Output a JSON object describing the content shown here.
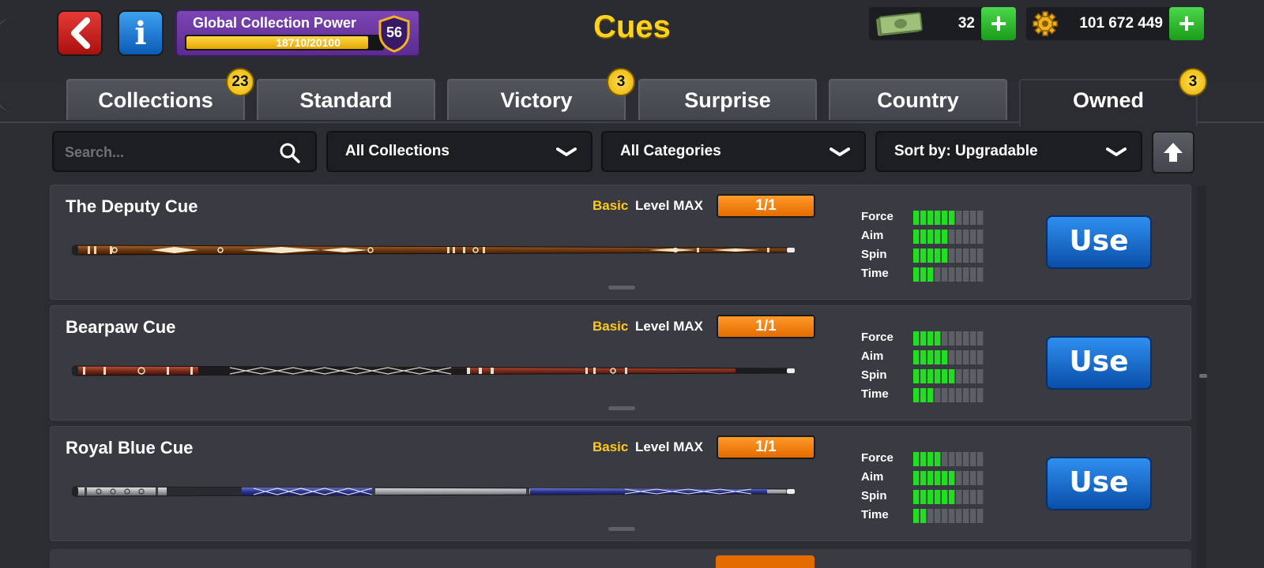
{
  "header": {
    "title": "Cues",
    "collection_power": {
      "label": "Global Collection Power",
      "progress_text": "18710/20100",
      "progress_fraction": 0.93,
      "level": "56"
    },
    "cash": {
      "amount": "32",
      "icon": "cash-icon"
    },
    "coins": {
      "amount": "101 672 449",
      "icon": "coin-gear-icon"
    }
  },
  "tabs": [
    {
      "label": "Collections",
      "badge": "23",
      "active": false
    },
    {
      "label": "Standard",
      "badge": "",
      "active": false
    },
    {
      "label": "Victory",
      "badge": "3",
      "active": false
    },
    {
      "label": "Surprise",
      "badge": "",
      "active": false
    },
    {
      "label": "Country",
      "badge": "",
      "active": false
    },
    {
      "label": "Owned",
      "badge": "3",
      "active": true
    }
  ],
  "filters": {
    "search_placeholder": "Search...",
    "collection": "All Collections",
    "category": "All Categories",
    "sort": "Sort by: Upgradable"
  },
  "cues": [
    {
      "name": "The Deputy Cue",
      "rarity": "Basic",
      "level_label": "Level MAX",
      "level_value": "1/1",
      "stats": [
        {
          "label": "Force",
          "value": 6
        },
        {
          "label": "Aim",
          "value": 5
        },
        {
          "label": "Spin",
          "value": 5
        },
        {
          "label": "Time",
          "value": 3
        }
      ],
      "use_label": "Use"
    },
    {
      "name": "Bearpaw Cue",
      "rarity": "Basic",
      "level_label": "Level MAX",
      "level_value": "1/1",
      "stats": [
        {
          "label": "Force",
          "value": 4
        },
        {
          "label": "Aim",
          "value": 5
        },
        {
          "label": "Spin",
          "value": 6
        },
        {
          "label": "Time",
          "value": 3
        }
      ],
      "use_label": "Use"
    },
    {
      "name": "Royal Blue Cue",
      "rarity": "Basic",
      "level_label": "Level MAX",
      "level_value": "1/1",
      "stats": [
        {
          "label": "Force",
          "value": 4
        },
        {
          "label": "Aim",
          "value": 6
        },
        {
          "label": "Spin",
          "value": 6
        },
        {
          "label": "Time",
          "value": 2
        }
      ],
      "use_label": "Use"
    }
  ],
  "stat_max": 10,
  "colors": {
    "title": "#ffd21e",
    "stat_on": "#22dd22",
    "stat_off": "#5d5f66",
    "level_badge": "#ff8a14",
    "use_button": "#1a6fd6",
    "rarity": "#ffc81f"
  }
}
